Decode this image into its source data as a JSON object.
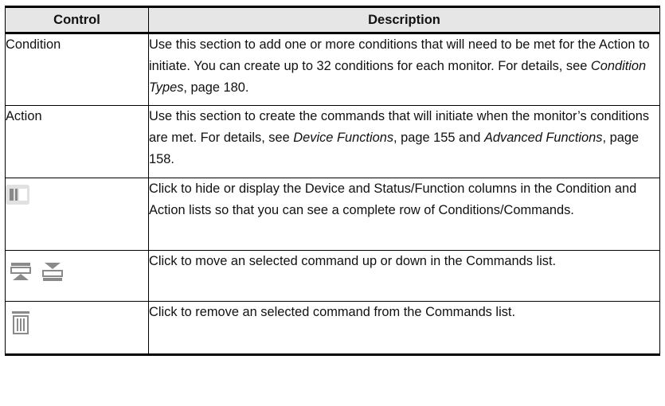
{
  "table": {
    "headers": {
      "control": "Control",
      "description": "Description"
    },
    "rows": [
      {
        "control": "Condition",
        "desc_pre": "Use this section to add one or more conditions that will need to be met for the Action to initiate. You can create up to 32 conditions for each monitor. For details, see ",
        "link1": "Condition Types",
        "desc_post": ", page 180."
      },
      {
        "control": "Action",
        "desc_pre": "Use this section to create the commands that will initiate when the monitor’s conditions are met. For details, see ",
        "link1": "Device Functions",
        "desc_mid": ", page 155 and ",
        "link2": "Advanced Functions",
        "desc_post": ", page 158."
      },
      {
        "control_icon": "column-toggle-icon",
        "desc": "Click to hide or display the Device and Status/Function columns in the Condition and Action lists so that you can see a complete row of Conditions/Commands."
      },
      {
        "control_icons": [
          "move-up-icon",
          "move-down-icon"
        ],
        "desc": "Click to move an selected command up or down in the Commands list."
      },
      {
        "control_icon": "trash-icon",
        "desc": "Click to remove an selected command from the Commands list."
      }
    ]
  },
  "colors": {
    "header_bg": "#e6e6e6",
    "icon_gray": "#8a8a8a",
    "icon_bg": "#e1e1e1"
  }
}
